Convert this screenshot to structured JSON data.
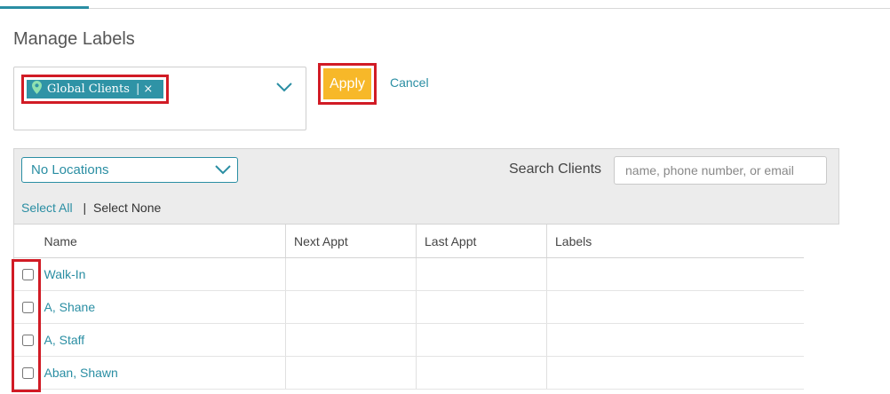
{
  "page": {
    "title": "Manage Labels"
  },
  "label_picker": {
    "tags": [
      {
        "label": "Global Clients",
        "separator": "|",
        "remove_glyph": "×",
        "icon": "map-pin-icon"
      }
    ]
  },
  "actions": {
    "apply_label": "Apply",
    "cancel_label": "Cancel"
  },
  "filters": {
    "location_selected": "No Locations",
    "search_label": "Search Clients",
    "search_placeholder": "name, phone number, or email",
    "select_all": "Select All",
    "separator": "|",
    "select_none": "Select None"
  },
  "table": {
    "headers": [
      "Name",
      "Next Appt",
      "Last Appt",
      "Labels"
    ],
    "rows": [
      {
        "name": "Walk-In"
      },
      {
        "name": "A, Shane"
      },
      {
        "name": "A, Staff"
      },
      {
        "name": "Aban, Shawn"
      }
    ]
  },
  "colors": {
    "accent": "#2a8ea3",
    "apply": "#f7b829",
    "highlight": "#d11b25",
    "tag_bg": "#2f93a6"
  }
}
